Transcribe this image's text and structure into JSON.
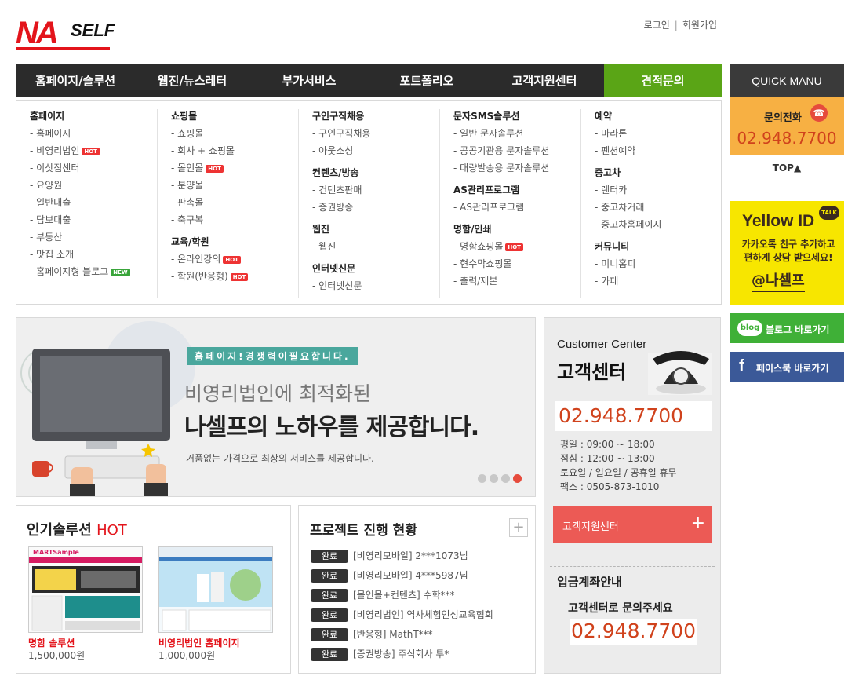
{
  "header": {
    "logo": {
      "brand": "NA",
      "suffix": "SELF"
    },
    "links": {
      "login": "로그인",
      "separator": "|",
      "signup": "회원가입"
    }
  },
  "nav": {
    "items": [
      {
        "label": "홈페이지/솔루션"
      },
      {
        "label": "웹진/뉴스레터"
      },
      {
        "label": "부가서비스"
      },
      {
        "label": "포트폴리오"
      },
      {
        "label": "고객지원센터"
      },
      {
        "label": "견적문의"
      }
    ]
  },
  "mega": {
    "col1": {
      "h1": "홈페이지",
      "items": [
        "홈페이지",
        "비영리법인",
        "이삿짐센터",
        "요양원",
        "일반대출",
        "담보대출",
        "부동산",
        "맛집 소개",
        "홈페이지형 블로그"
      ]
    },
    "col2": {
      "h1": "쇼핑몰",
      "items": [
        "쇼핑몰",
        "회사 + 쇼핑몰",
        "몰인몰",
        "분양몰",
        "판촉몰",
        "축구복"
      ],
      "h2": "교육/학원",
      "items2": [
        "온라인강의",
        "학원(반응형)"
      ]
    },
    "col3": {
      "h1": "구인구직채용",
      "items": [
        "구인구직채용",
        "아웃소싱"
      ],
      "h2": "컨텐츠/방송",
      "items2": [
        "컨텐츠판매",
        "증권방송"
      ],
      "h3": "웹진",
      "items3": [
        "웹진"
      ],
      "h4": "인터넷신문",
      "items4": [
        "인터넷신문"
      ]
    },
    "col4": {
      "h1": "문자SMS솔루션",
      "items": [
        "일반 문자솔루션",
        "공공기관용 문자솔루션",
        "대량발송용 문자솔루션"
      ],
      "h2": "AS관리프로그램",
      "items2": [
        "AS관리프로그램"
      ],
      "h3": "명함/인쇄",
      "items3": [
        "명함쇼핑몰",
        "현수막쇼핑몰",
        "출력/제본"
      ]
    },
    "col5": {
      "h1": "예약",
      "items": [
        "마라톤",
        "펜션예약"
      ],
      "h2": "중고차",
      "items2": [
        "렌터카",
        "중고차거래",
        "중고차홈페이지"
      ],
      "h3": "커뮤니티",
      "items3": [
        "미니홈피",
        "카페"
      ]
    },
    "badges": {
      "hot": "HOT",
      "new": "NEW"
    }
  },
  "quick": {
    "title": "QUICK MANU",
    "phone_label": "문의전화",
    "phone": "02.948.7700",
    "top": "TOP▲",
    "yellow": {
      "brand": "Yellow ID",
      "talk": "TALK",
      "line1": "카카오톡 친구 추가하고",
      "line2": "편하게 상담 받으세요!",
      "handle": "@나셀프"
    },
    "blog": {
      "icon": "blog",
      "label": "블로그 바로가기"
    },
    "facebook": {
      "icon": "f",
      "label": "페이스북 바로가기"
    }
  },
  "banner": {
    "tag": "홈페이지!경쟁력이필요합니다.",
    "line1": "비영리법인에 최적화된",
    "line2": "나셀프의 노하우를 제공합니다.",
    "line3": "거품없는 가격으로 최상의 서비스를 제공합니다.",
    "slides": 4,
    "active_slide": 4
  },
  "customer": {
    "title_en": "Customer Center",
    "title_ko": "고객센터",
    "phone": "02.948.7700",
    "hours": [
      "평일 : 09:00 ~ 18:00",
      "점심 : 12:00 ~ 13:00",
      "토요일 / 일요일 / 공휴일 휴무",
      "팩스 : 0505-873-1010"
    ],
    "button": "고객지원센터",
    "button_plus": "+",
    "bank_title": "입금계좌안내",
    "bank_ask": "고객센터로 문의주세요",
    "bank_phone": "02.948.7700"
  },
  "popular": {
    "title": "인기솔루션",
    "hot": "HOT",
    "items": [
      {
        "name": "명함 솔루션",
        "price": "1,500,000원",
        "thumb_brand": "MARTSample"
      },
      {
        "name": "비영리법인 홈페이지",
        "price": "1,000,000원"
      }
    ]
  },
  "projects": {
    "title": "프로젝트 진행 현황",
    "plus": "+",
    "rows": [
      {
        "status": "완료",
        "text": "[비영리모바일] 2***1073님"
      },
      {
        "status": "완료",
        "text": "[비영리모바일] 4***5987님"
      },
      {
        "status": "완료",
        "text": "[몰인몰+컨텐츠] 수학***"
      },
      {
        "status": "완료",
        "text": "[비영리법인] 역사체험인성교육협회"
      },
      {
        "status": "완료",
        "text": "[반응형] MathT***"
      },
      {
        "status": "완료",
        "text": "[증권방송] 주식회사 투*"
      }
    ]
  }
}
